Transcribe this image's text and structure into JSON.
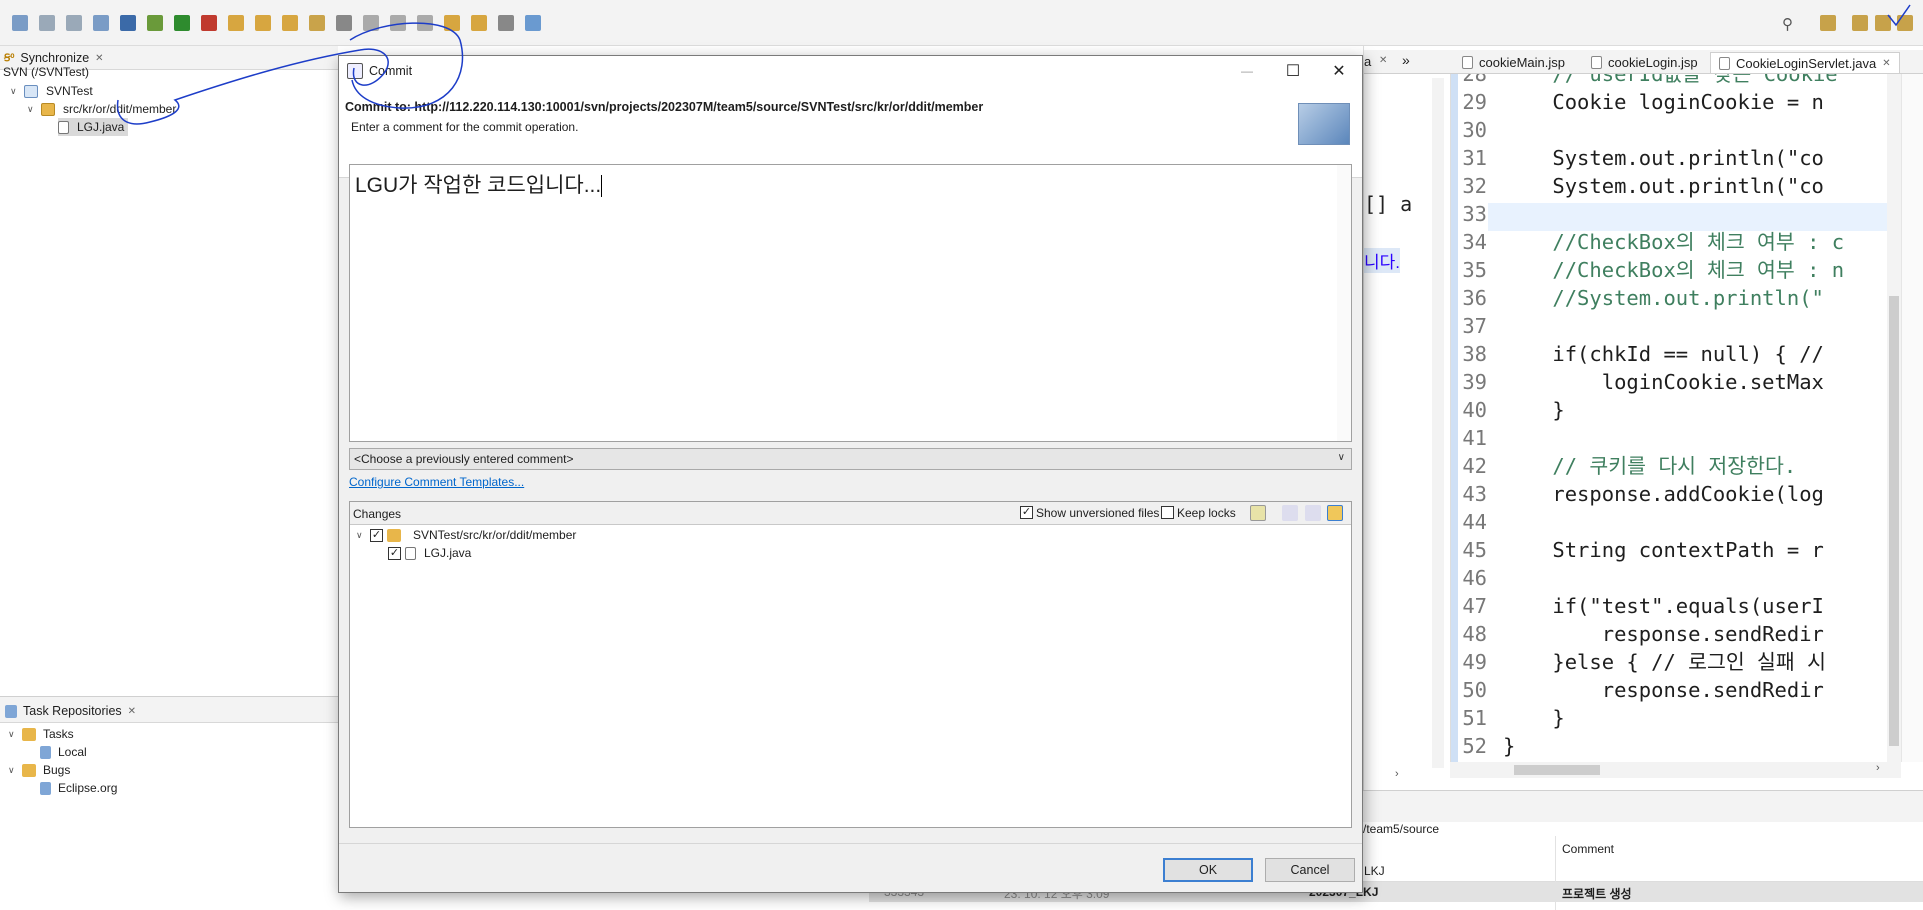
{
  "left_top_pane": {
    "tab_label": "Synchronize",
    "tab_glyph": "Ꞩ⁰",
    "breadcrumb": "SVN (/SVNTest)",
    "tree": [
      {
        "label": "SVNTest"
      },
      {
        "label": "src/kr/or/ddit/member"
      },
      {
        "label": "LGJ.java"
      }
    ]
  },
  "left_bottom_pane": {
    "tab_label": "Task Repositories",
    "tree": [
      {
        "label": "Tasks"
      },
      {
        "label": "Local"
      },
      {
        "label": "Bugs"
      },
      {
        "label": "Eclipse.org"
      }
    ]
  },
  "editor": {
    "tabs": [
      {
        "label": "cookieMain.jsp"
      },
      {
        "label": "cookieLogin.jsp"
      },
      {
        "label": "CookieLoginServlet.java"
      }
    ],
    "partial_tab": "a",
    "partial_overflow": "»",
    "hidden_fragments": [
      "[] a",
      "니다."
    ],
    "lines": [
      {
        "n": "28",
        "text": "    // userId값을 갖는 Cookie"
      },
      {
        "n": "29",
        "text": "    Cookie loginCookie = n"
      },
      {
        "n": "30",
        "text": ""
      },
      {
        "n": "31",
        "text": "    System.out.println(\"co"
      },
      {
        "n": "32",
        "text": "    System.out.println(\"co"
      },
      {
        "n": "33",
        "text": ""
      },
      {
        "n": "34",
        "text": "    //CheckBox의 체크 여부 : c"
      },
      {
        "n": "35",
        "text": "    //CheckBox의 체크 여부 : n"
      },
      {
        "n": "36",
        "text": "    //System.out.println(\""
      },
      {
        "n": "37",
        "text": ""
      },
      {
        "n": "38",
        "text": "    if(chkId == null) { //"
      },
      {
        "n": "39",
        "text": "        loginCookie.setMax"
      },
      {
        "n": "40",
        "text": "    }"
      },
      {
        "n": "41",
        "text": ""
      },
      {
        "n": "42",
        "text": "    // 쿠키를 다시 저장한다."
      },
      {
        "n": "43",
        "text": "    response.addCookie(log"
      },
      {
        "n": "44",
        "text": ""
      },
      {
        "n": "45",
        "text": "    String contextPath = r"
      },
      {
        "n": "46",
        "text": ""
      },
      {
        "n": "47",
        "text": "    if(\"test\".equals(userI"
      },
      {
        "n": "48",
        "text": "        response.sendRedir"
      },
      {
        "n": "49",
        "text": "    }else { // 로그인 실패 시"
      },
      {
        "n": "50",
        "text": "        response.sendRedir"
      },
      {
        "n": "51",
        "text": "    }"
      },
      {
        "n": "52",
        "text": "}"
      }
    ]
  },
  "dialog": {
    "title": "Commit",
    "commit_to": "Commit to: http://112.220.114.130:10001/svn/projects/202307M/team5/source/SVNTest/src/kr/or/ddit/member",
    "instruction": "Enter a comment for the commit operation.",
    "comment_value": "LGU가 작업한 코드입니다...",
    "previous_comment_placeholder": "<Choose a previously entered comment>",
    "configure_link": "Configure Comment Templates...",
    "changes_label": "Changes",
    "show_unversioned_label": "Show unversioned files",
    "show_unversioned_checked": true,
    "keep_locks_label": "Keep locks",
    "keep_locks_checked": false,
    "change_tree": [
      {
        "label": "SVNTest/src/kr/or/ddit/member",
        "checked": true
      },
      {
        "label": "LGJ.java",
        "checked": true
      }
    ],
    "ok_label": "OK",
    "cancel_label": "Cancel",
    "window_controls": {
      "minimize": "—",
      "maximize": "☐",
      "close": "✕"
    }
  },
  "history_pane": {
    "path_fragment": "/team5/source",
    "comment_header": "Comment",
    "row_author": "202307_LKJ",
    "row_author_above": "LKJ",
    "row_comment": "프로젝트 생성",
    "row_revision_fragment": "333343",
    "row_date_fragment": "23. 10. 12 오후 3:09"
  },
  "colors": {
    "accent_blue": "#3c7fd1",
    "link_blue": "#0066cc",
    "annotation_ink": "#1d3dc8",
    "folder_yellow": "#e8b64a",
    "keyword": "#7f0055",
    "string": "#2a00ff",
    "comment": "#3f7f5f"
  }
}
